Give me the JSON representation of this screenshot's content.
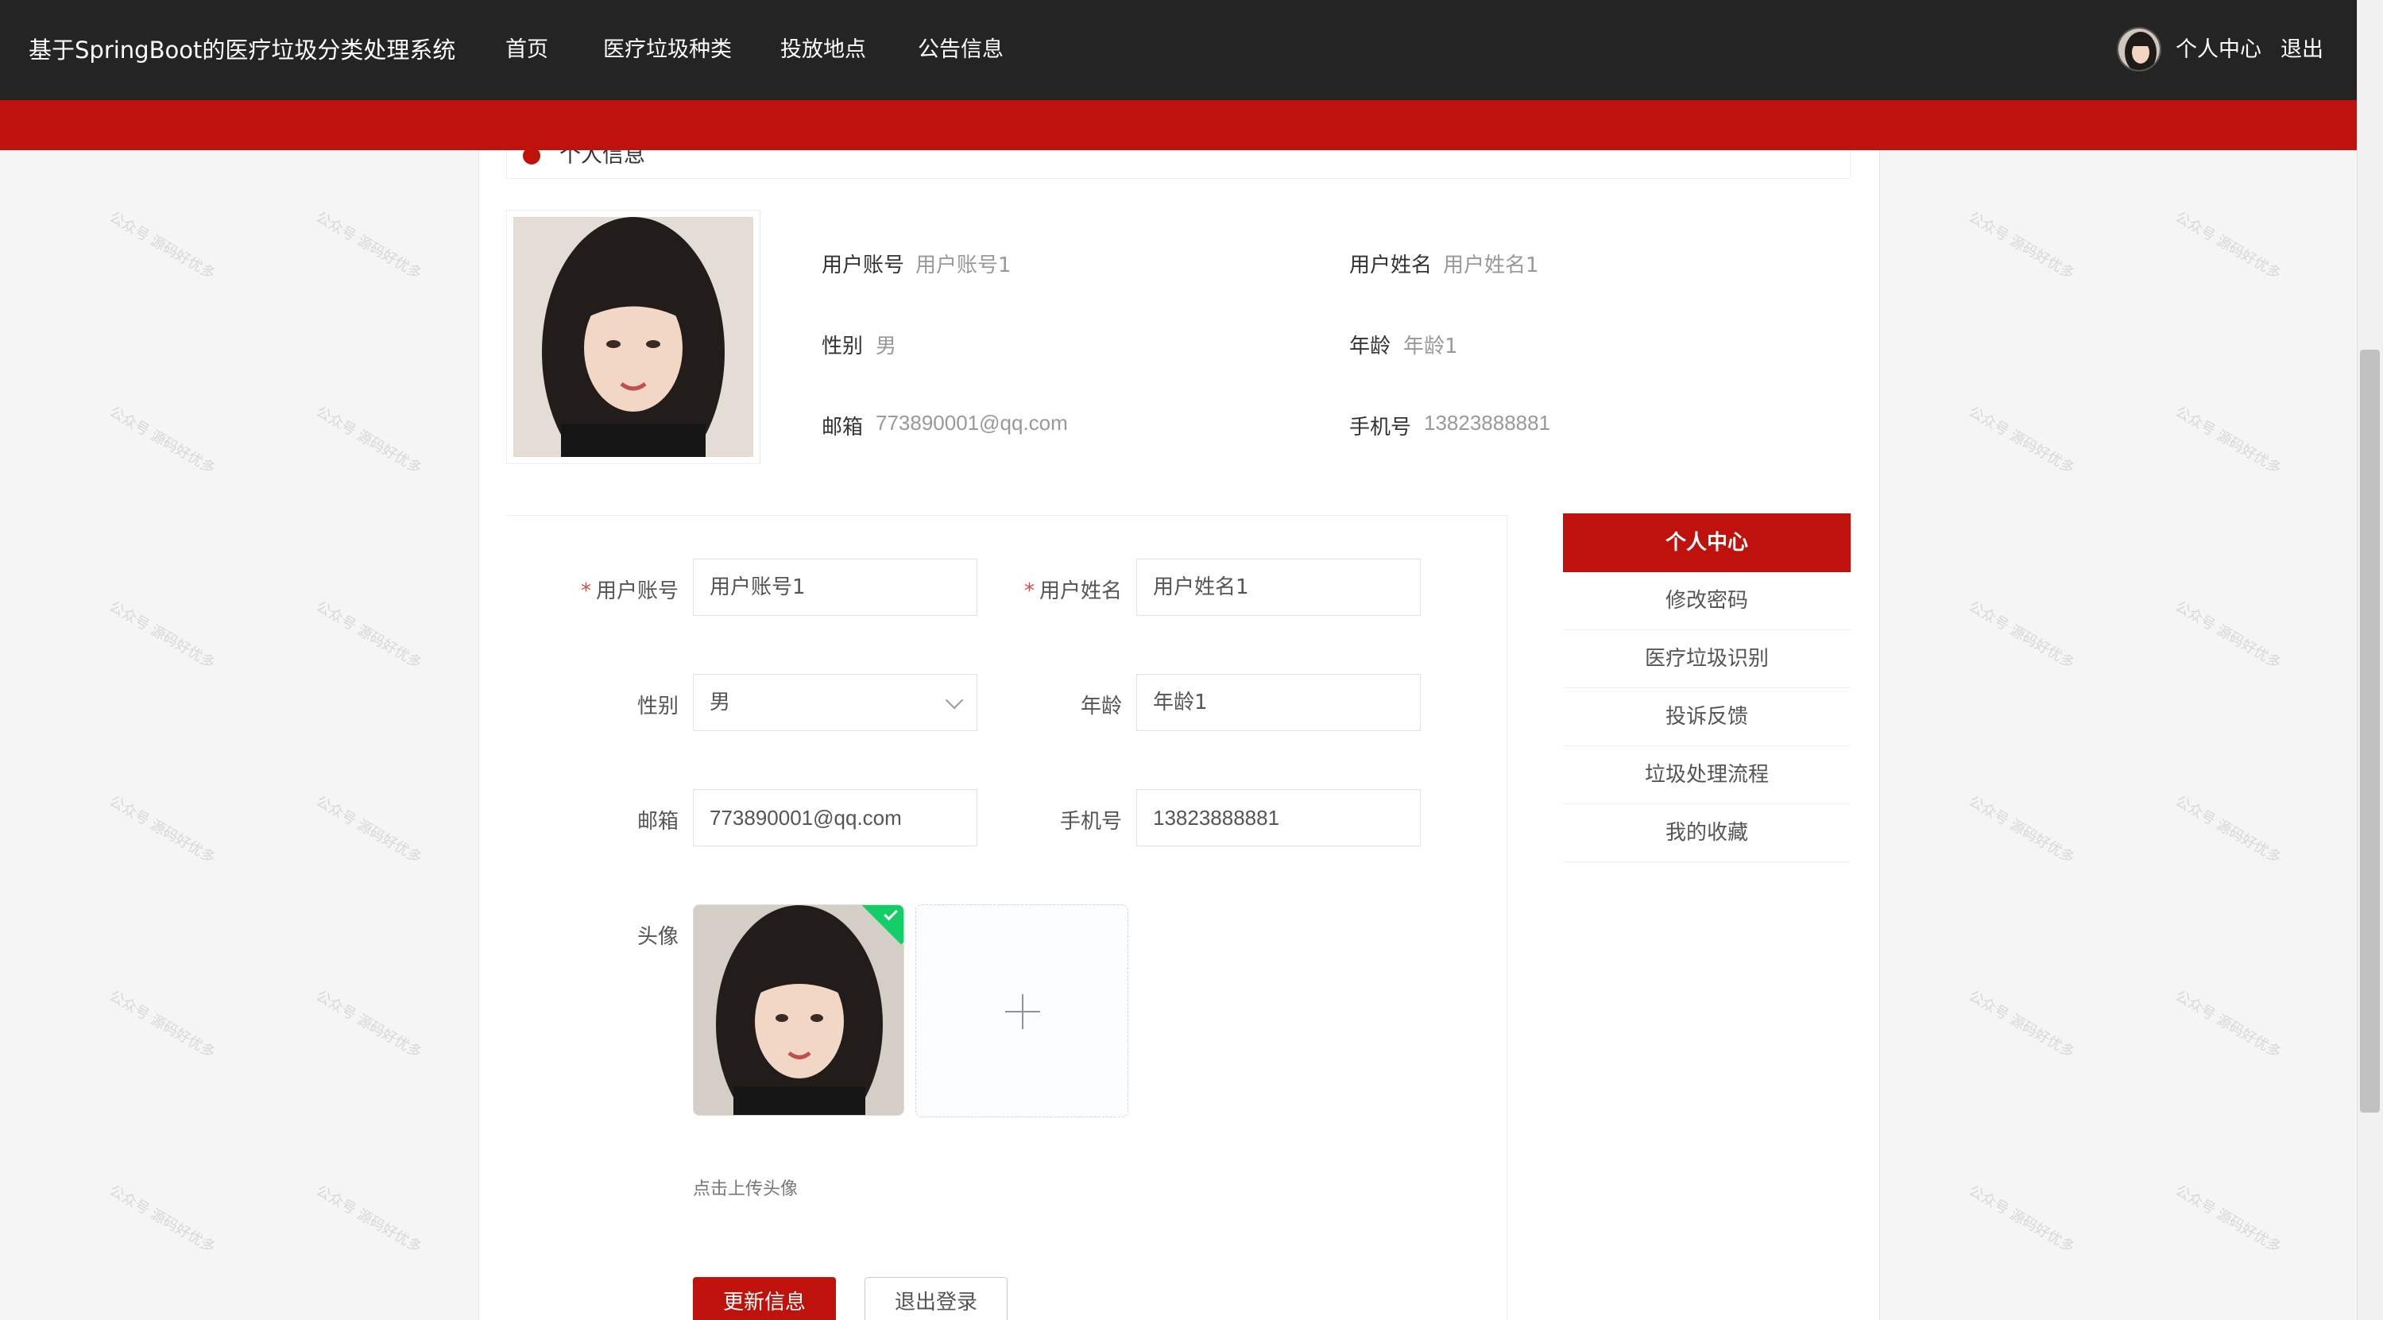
{
  "header": {
    "brand": "基于SpringBoot的医疗垃圾分类处理系统",
    "nav": [
      "首页",
      "医疗垃圾种类",
      "投放地点",
      "公告信息"
    ],
    "profile_link": "个人中心",
    "logout_link": "退出"
  },
  "section": {
    "title": "个人信息"
  },
  "profile_info": {
    "account_label": "用户账号",
    "account_value": "用户账号1",
    "name_label": "用户姓名",
    "name_value": "用户姓名1",
    "gender_label": "性别",
    "gender_value": "男",
    "age_label": "年龄",
    "age_value": "年龄1",
    "email_label": "邮箱",
    "email_value": "773890001@qq.com",
    "phone_label": "手机号",
    "phone_value": "13823888881"
  },
  "form": {
    "account_label": "用户账号",
    "account_value": "用户账号1",
    "name_label": "用户姓名",
    "name_value": "用户姓名1",
    "gender_label": "性别",
    "gender_value": "男",
    "age_label": "年龄",
    "age_value": "年龄1",
    "email_label": "邮箱",
    "email_value": "773890001@qq.com",
    "phone_label": "手机号",
    "phone_value": "13823888881",
    "avatar_label": "头像",
    "upload_tip": "点击上传头像",
    "submit_label": "更新信息",
    "logout_label": "退出登录",
    "required_mark": "*"
  },
  "side_menu": {
    "active": "个人中心",
    "items": [
      "修改密码",
      "医疗垃圾识别",
      "投诉反馈",
      "垃圾处理流程",
      "我的收藏"
    ]
  },
  "watermark": "公众号 源码好优多",
  "colors": {
    "brand_red": "#c0120d",
    "header_dark": "#242424",
    "success_green": "#13ce66"
  },
  "icons": [
    "avatar",
    "chevron-down-icon",
    "plus-icon",
    "check-icon"
  ]
}
